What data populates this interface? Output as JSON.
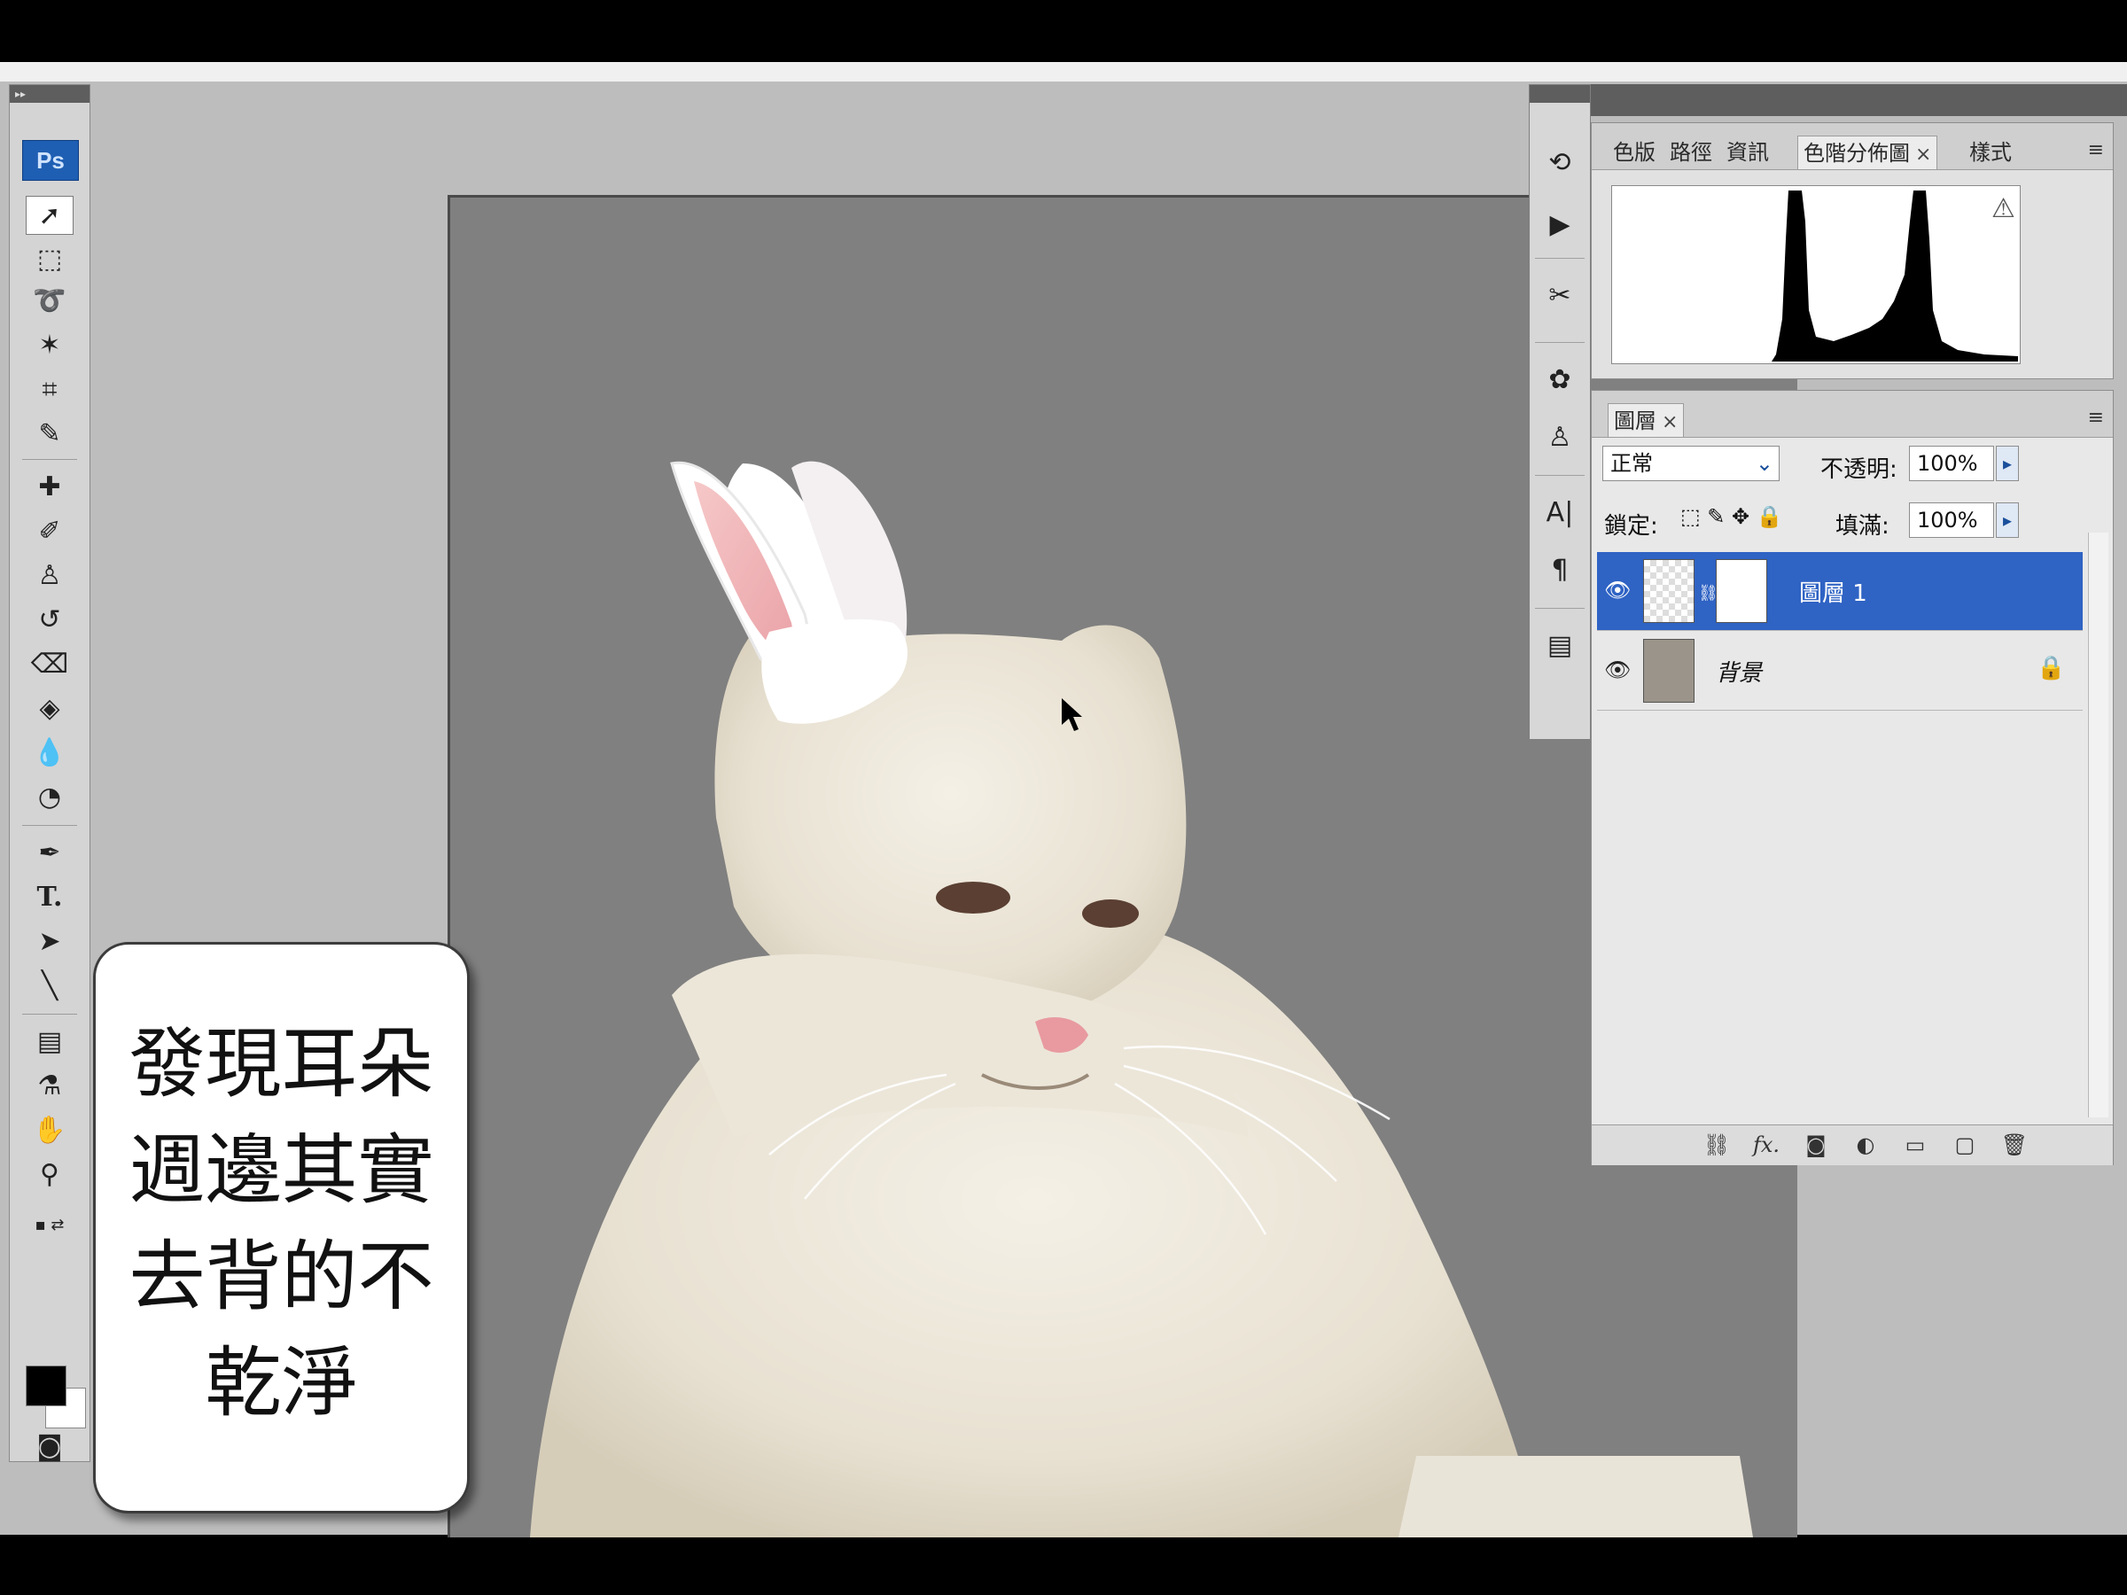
{
  "toolbox": {
    "logo": "Ps",
    "tools": [
      "move-tool",
      "marquee-tool",
      "lasso-tool",
      "magic-wand-tool",
      "crop-tool",
      "slice-tool",
      "healing-brush-tool",
      "brush-tool",
      "clone-stamp-tool",
      "history-brush-tool",
      "eraser-tool",
      "paint-bucket-tool",
      "blur-tool",
      "dodge-tool",
      "pen-tool",
      "type-tool",
      "path-selection-tool",
      "line-tool",
      "notes-tool",
      "eyedropper-tool",
      "hand-tool",
      "zoom-tool"
    ],
    "type_tool_glyph": "T.",
    "foreground_color": "#000000",
    "background_color": "#ffffff"
  },
  "histogram_panel": {
    "tabs": [
      "色版",
      "路徑",
      "資訊",
      "色階分佈圖",
      "樣式"
    ],
    "active_tab": "色階分佈圖",
    "close_glyph": "×"
  },
  "layers_panel": {
    "tab": "圖層",
    "blend_mode": "正常",
    "opacity_label": "不透明:",
    "opacity_value": "100%",
    "lock_label": "鎖定:",
    "fill_label": "填滿:",
    "fill_value": "100%",
    "layers": [
      {
        "name": "圖層 1",
        "selected": true,
        "has_mask": true
      },
      {
        "name": "背景",
        "selected": false,
        "locked": true
      }
    ],
    "footer_buttons": [
      "link-icon",
      "fx-icon",
      "mask-icon",
      "adjustment-icon",
      "group-icon",
      "new-layer-icon",
      "trash-icon"
    ],
    "fx_label": "fx."
  },
  "right_dock": {
    "buttons": [
      "history-icon",
      "actions-icon",
      "tools-preset-icon",
      "brushes-icon",
      "clone-source-icon",
      "character-icon",
      "paragraph-icon",
      "layer-comps-icon"
    ],
    "character_glyph": "A|",
    "paragraph_glyph": "¶"
  },
  "caption": {
    "lines": [
      "發現耳朵",
      "週邊其實",
      "去背的不",
      "乾淨"
    ]
  },
  "colors": {
    "canvas_bg": "#808080",
    "workspace_bg": "#bdbdbd",
    "selection_blue": "#2f63c4",
    "ps_logo": "#1f5fb3"
  }
}
